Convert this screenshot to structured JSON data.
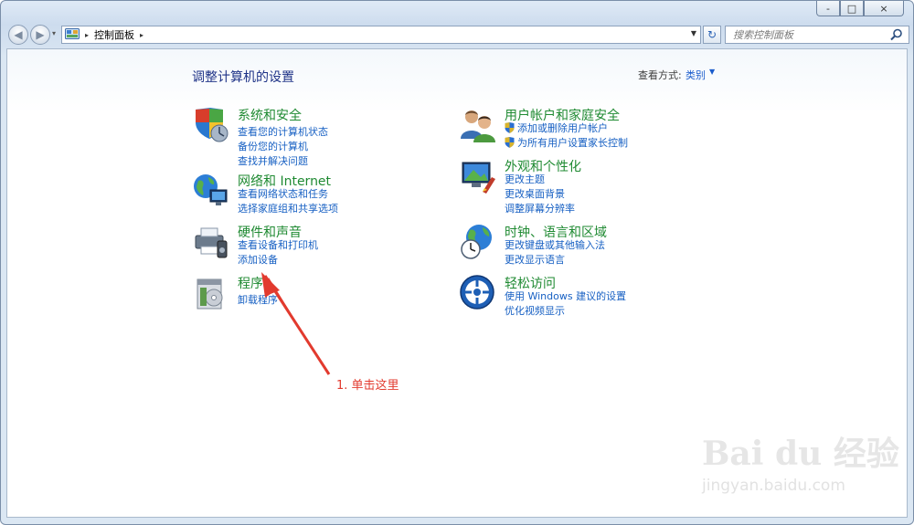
{
  "window": {
    "controls": {
      "minimize": "-",
      "maximize": "□",
      "close": "×"
    }
  },
  "nav": {
    "back_icon": "back-arrow",
    "forward_icon": "forward-arrow",
    "address": {
      "crumb": "控制面板",
      "separator": "▸"
    },
    "refresh_icon": "refresh",
    "search_placeholder": "搜索控制面板"
  },
  "header": {
    "title": "调整计算机的设置",
    "view_by_label": "查看方式:",
    "view_by_value": "类别"
  },
  "categories": [
    {
      "title": "系统和安全",
      "icon": "system-security-icon",
      "links": [
        "查看您的计算机状态",
        "备份您的计算机",
        "查找并解决问题"
      ]
    },
    {
      "title": "网络和 Internet",
      "icon": "network-icon",
      "links": [
        "查看网络状态和任务",
        "选择家庭组和共享选项"
      ]
    },
    {
      "title": "硬件和声音",
      "icon": "hardware-sound-icon",
      "links": [
        "查看设备和打印机",
        "添加设备"
      ]
    },
    {
      "title": "程序",
      "icon": "programs-icon",
      "links": [
        "卸载程序"
      ]
    },
    {
      "title": "用户帐户和家庭安全",
      "icon": "user-accounts-icon",
      "links": [
        "添加或删除用户帐户",
        "为所有用户设置家长控制"
      ],
      "shielded": true
    },
    {
      "title": "外观和个性化",
      "icon": "appearance-icon",
      "links": [
        "更改主题",
        "更改桌面背景",
        "调整屏幕分辨率"
      ]
    },
    {
      "title": "时钟、语言和区域",
      "icon": "clock-region-icon",
      "links": [
        "更改键盘或其他输入法",
        "更改显示语言"
      ]
    },
    {
      "title": "轻松访问",
      "icon": "ease-of-access-icon",
      "links": [
        "使用 Windows 建议的设置",
        "优化视频显示"
      ]
    }
  ],
  "annotation": {
    "text": "1. 单击这里",
    "color": "#e23a2e"
  },
  "watermark": {
    "main": "Bai du 经验",
    "sub": "jingyan.baidu.com"
  },
  "colors": {
    "category_title": "#1f8a32",
    "link": "#1760c3",
    "page_title": "#1e3287"
  }
}
